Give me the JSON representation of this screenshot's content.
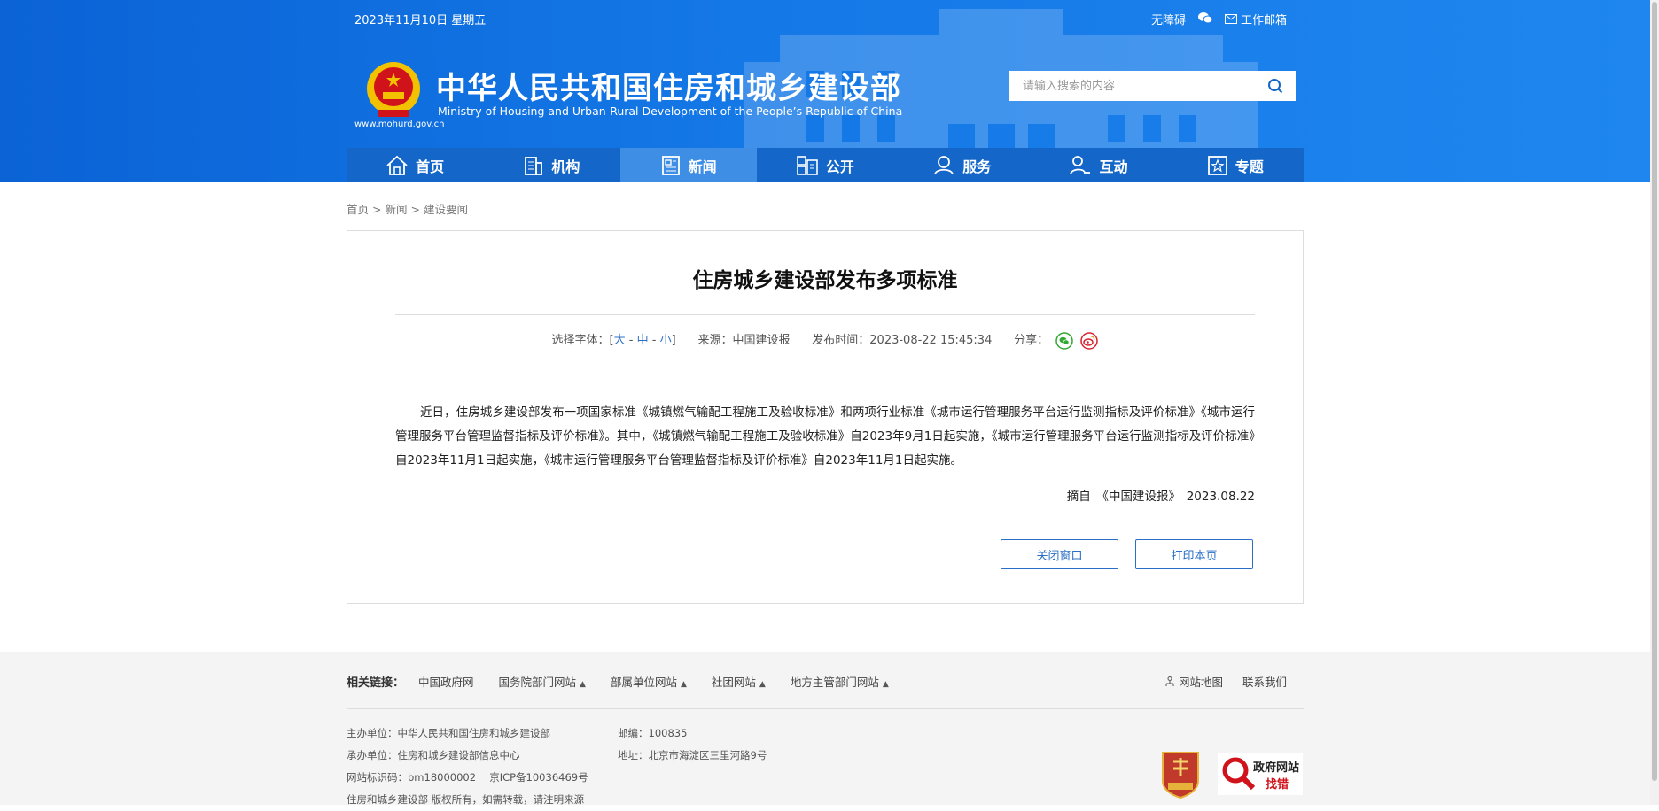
{
  "header": {
    "date": "2023年11月10日 星期五",
    "accessibility": "无障碍",
    "mailbox": "工作邮箱",
    "site_url": "www.mohurd.gov.cn",
    "title_cn": "中华人民共和国住房和城乡建设部",
    "title_en": "Ministry of Housing and Urban-Rural Development of the People’s Republic of China",
    "search_placeholder": "请输入搜索的内容"
  },
  "nav": {
    "items": [
      {
        "label": "首页",
        "icon": "home-icon"
      },
      {
        "label": "机构",
        "icon": "building-icon"
      },
      {
        "label": "新闻",
        "icon": "news-icon",
        "active": true
      },
      {
        "label": "公开",
        "icon": "disclosure-icon"
      },
      {
        "label": "服务",
        "icon": "service-icon"
      },
      {
        "label": "互动",
        "icon": "interaction-icon"
      },
      {
        "label": "专题",
        "icon": "topic-icon"
      }
    ]
  },
  "breadcrumb": {
    "home": "首页",
    "sep": ">",
    "news": "新闻",
    "current": "建设要闻"
  },
  "article": {
    "title": "住房城乡建设部发布多项标准",
    "font_label": "选择字体：[",
    "font_large": "大",
    "font_medium": "中",
    "font_small": "小",
    "font_close": "]",
    "source": "来源：中国建设报",
    "publish_time": "发布时间：2023-08-22 15:45:34",
    "share_label": "分享：",
    "body": "近日，住房城乡建设部发布一项国家标准《城镇燃气输配工程施工及验收标准》和两项行业标准《城市运行管理服务平台运行监测指标及评价标准》《城市运行管理服务平台管理监督指标及评价标准》。其中，《城镇燃气输配工程施工及验收标准》自2023年9月1日起实施，《城市运行管理服务平台运行监测指标及评价标准》自2023年11月1日起实施，《城市运行管理服务平台管理监督指标及评价标准》自2023年11月1日起实施。",
    "excerpt": "摘自　《中国建设报》　2023.08.22",
    "close_button": "关闭窗口",
    "print_button": "打印本页"
  },
  "footer": {
    "links_label": "相关链接：",
    "links": [
      "中国政府网",
      "国务院部门网站",
      "部属单位网站",
      "社团网站",
      "地方主管部门网站"
    ],
    "sitemap": "网站地图",
    "contact": "联系我们",
    "sponsor": "主办单位：中华人民共和国住房和城乡建设部",
    "organizer": "承办单位：住房和城乡建设部信息中心",
    "site_id": "网站标识码：bm18000002　 京ICP备10036469号",
    "copyright": "住房和城乡建设部 版权所有，如需转载，请注明来源",
    "postcode": "邮编：100835",
    "address": "地址：北京市海淀区三里河路9号",
    "badge2_line1": "政府网站",
    "badge2_line2": "找错"
  },
  "colors": {
    "header_blue": "#1478e6",
    "nav_blue": "#1467c8",
    "nav_active": "#3f8ee6",
    "link_blue": "#2a6fc7"
  }
}
